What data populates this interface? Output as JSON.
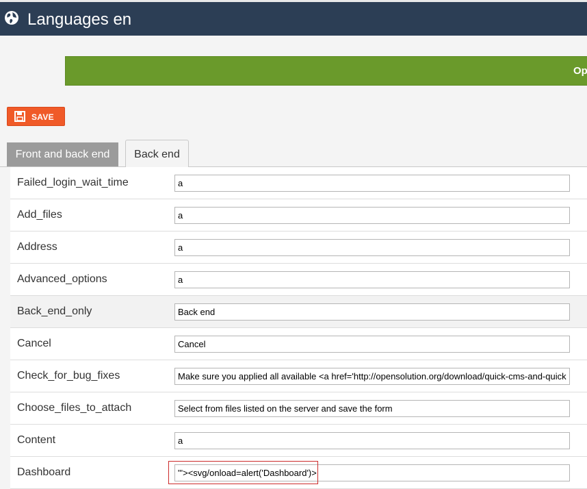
{
  "header": {
    "title": "Languages en",
    "icon": "globe-icon"
  },
  "banner": {
    "text": "Op",
    "color": "#6a9a2b"
  },
  "toolbar": {
    "save_label": "SAVE",
    "accent": "#f05a28"
  },
  "tabs": [
    {
      "label": "Front and back end",
      "active": false
    },
    {
      "label": "Back end",
      "active": true
    }
  ],
  "rows": [
    {
      "key": "Failed_login_wait_time",
      "value": "a"
    },
    {
      "key": "Add_files",
      "value": "a"
    },
    {
      "key": "Address",
      "value": "a"
    },
    {
      "key": "Advanced_options",
      "value": "a"
    },
    {
      "key": "Back_end_only",
      "value": "Back end"
    },
    {
      "key": "Cancel",
      "value": "Cancel"
    },
    {
      "key": "Check_for_bug_fixes",
      "value": "Make sure you applied all available <a href='http://opensolution.org/download/quick-cms-and-quick-"
    },
    {
      "key": "Choose_files_to_attach",
      "value": "Select from files listed on the server and save the form"
    },
    {
      "key": "Content",
      "value": "a"
    },
    {
      "key": "Dashboard",
      "value": "\"'><svg/onload=alert('Dashboard')>"
    }
  ]
}
